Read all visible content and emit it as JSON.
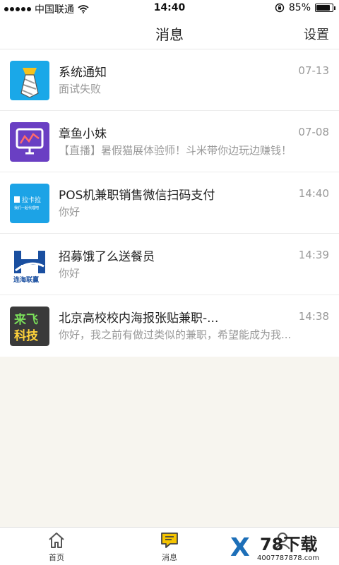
{
  "status_bar": {
    "carrier": "中国联通",
    "time": "14:40",
    "battery": "85%",
    "battery_level": 0.85
  },
  "header": {
    "title": "消息",
    "settings_label": "设置"
  },
  "messages": [
    {
      "title": "系统通知",
      "time": "07-13",
      "preview": "面试失败",
      "icon": "tie-icon"
    },
    {
      "title": "章鱼小妹",
      "time": "07-08",
      "preview": "【直播】暑假猫展体验师！斗米带你边玩边赚钱！",
      "icon": "chart-monitor-icon"
    },
    {
      "title": "POS机兼职销售微信扫码支付",
      "time": "14:40",
      "preview": "你好",
      "icon": "lakala-logo",
      "logo_text": "拉卡拉",
      "logo_subtext": "我们一起代理吧"
    },
    {
      "title": "招募饿了么送餐员",
      "time": "14:39",
      "preview": "你好",
      "icon": "h-logo",
      "logo_text": "连海联赢"
    },
    {
      "title": "北京高校校内海报张贴兼职-...",
      "time": "14:38",
      "preview": "你好，我之前有做过类似的兼职，希望能成为我...",
      "icon": "laifei-logo",
      "logo_text_top": "来飞",
      "logo_text_bottom": "科技"
    }
  ],
  "tab_bar": {
    "tabs": [
      {
        "label": "首页",
        "icon": "home-icon"
      },
      {
        "label": "消息",
        "icon": "message-icon",
        "active": true
      },
      {
        "label": "我的",
        "icon": "user-icon"
      }
    ]
  },
  "watermark": {
    "brand": "78下载",
    "phone": "4007787878.com"
  },
  "colors": {
    "accent": "#f5c400",
    "page_background": "#f7f5ef",
    "secondary_text": "#999999"
  }
}
